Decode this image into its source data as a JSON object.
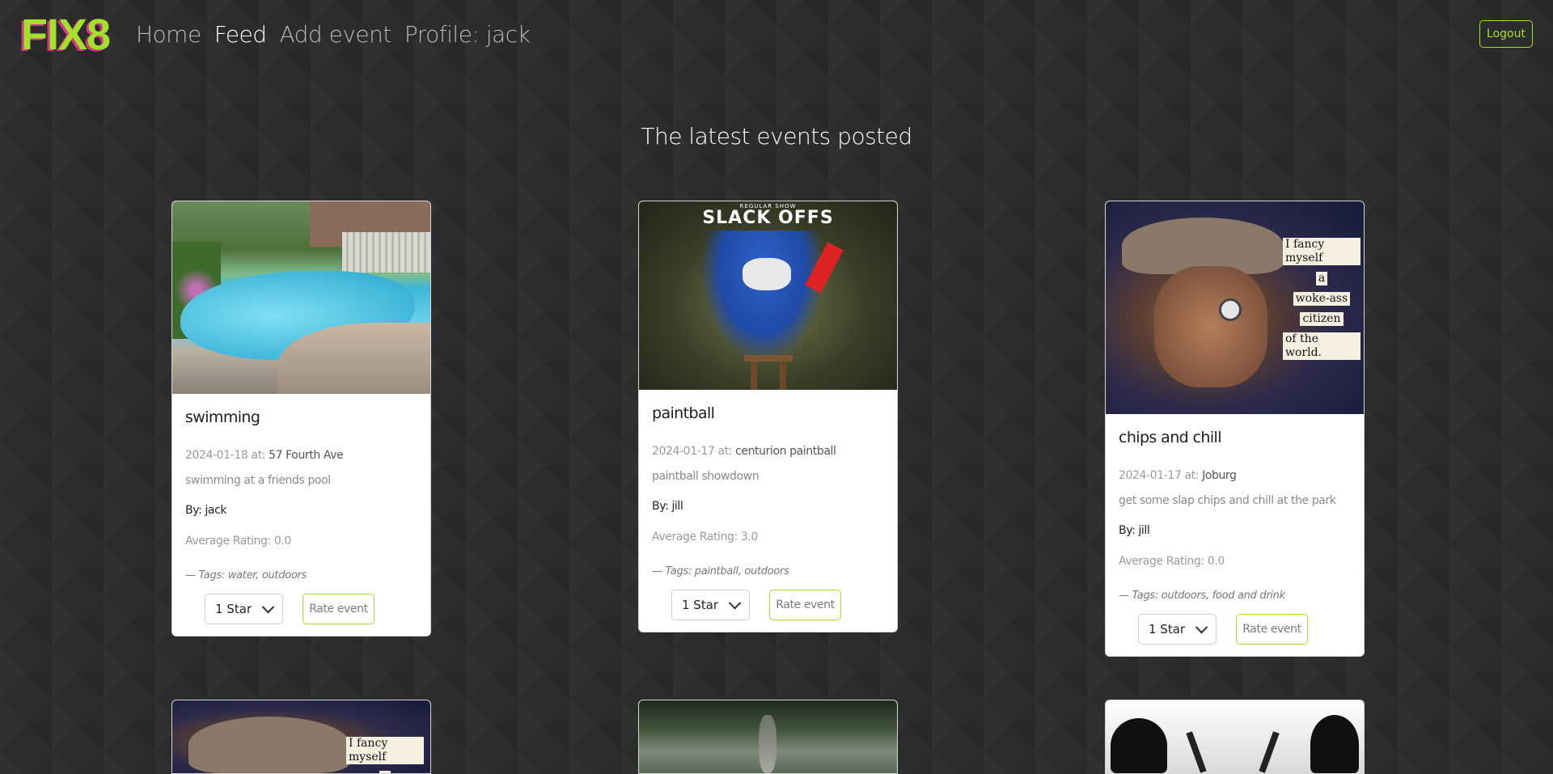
{
  "nav": {
    "brand": "FIX8",
    "links": [
      "Home",
      "Feed",
      "Add event",
      "Profile: jack"
    ],
    "logout_label": "Logout"
  },
  "page": {
    "heading": "The latest events posted"
  },
  "events": [
    {
      "title": "swimming",
      "date": "2024-01-18 at:",
      "location": "57 Fourth Ave",
      "description": "swimming at a friends pool",
      "by": "By: jack",
      "rating": "Average Rating: 0.0",
      "tags": "— Tags: water, outdoors",
      "rating_select": "1 Star",
      "rate_button": "Rate event"
    },
    {
      "title": "paintball",
      "date": "2024-01-17 at:",
      "location": "centurion paintball",
      "description": "paintball showdown",
      "by": "By: jill",
      "rating": "Average Rating: 3.0",
      "tags": "— Tags: paintball, outdoors",
      "rating_select": "1 Star",
      "rate_button": "Rate event",
      "image_text": {
        "subtitle": "REGULAR SHOW",
        "title": "SLACK OFFS"
      }
    },
    {
      "title": "chips and chill",
      "date": "2024-01-17 at:",
      "location": "Joburg",
      "description": "get some slap chips and chill at the park",
      "by": "By: jill",
      "rating": "Average Rating: 0.0",
      "tags": "— Tags: outdoors, food and drink",
      "rating_select": "1 Star",
      "rate_button": "Rate event",
      "image_text": [
        "I fancy myself",
        "a",
        "woke-ass",
        "citizen",
        "of the world."
      ]
    }
  ],
  "partial_cards": {
    "first_image_text": [
      "I fancy myself",
      "a"
    ]
  },
  "colors": {
    "accent": "#a4e22a",
    "brand_shadow": "#d8368e",
    "background": "#2c2c2c"
  }
}
